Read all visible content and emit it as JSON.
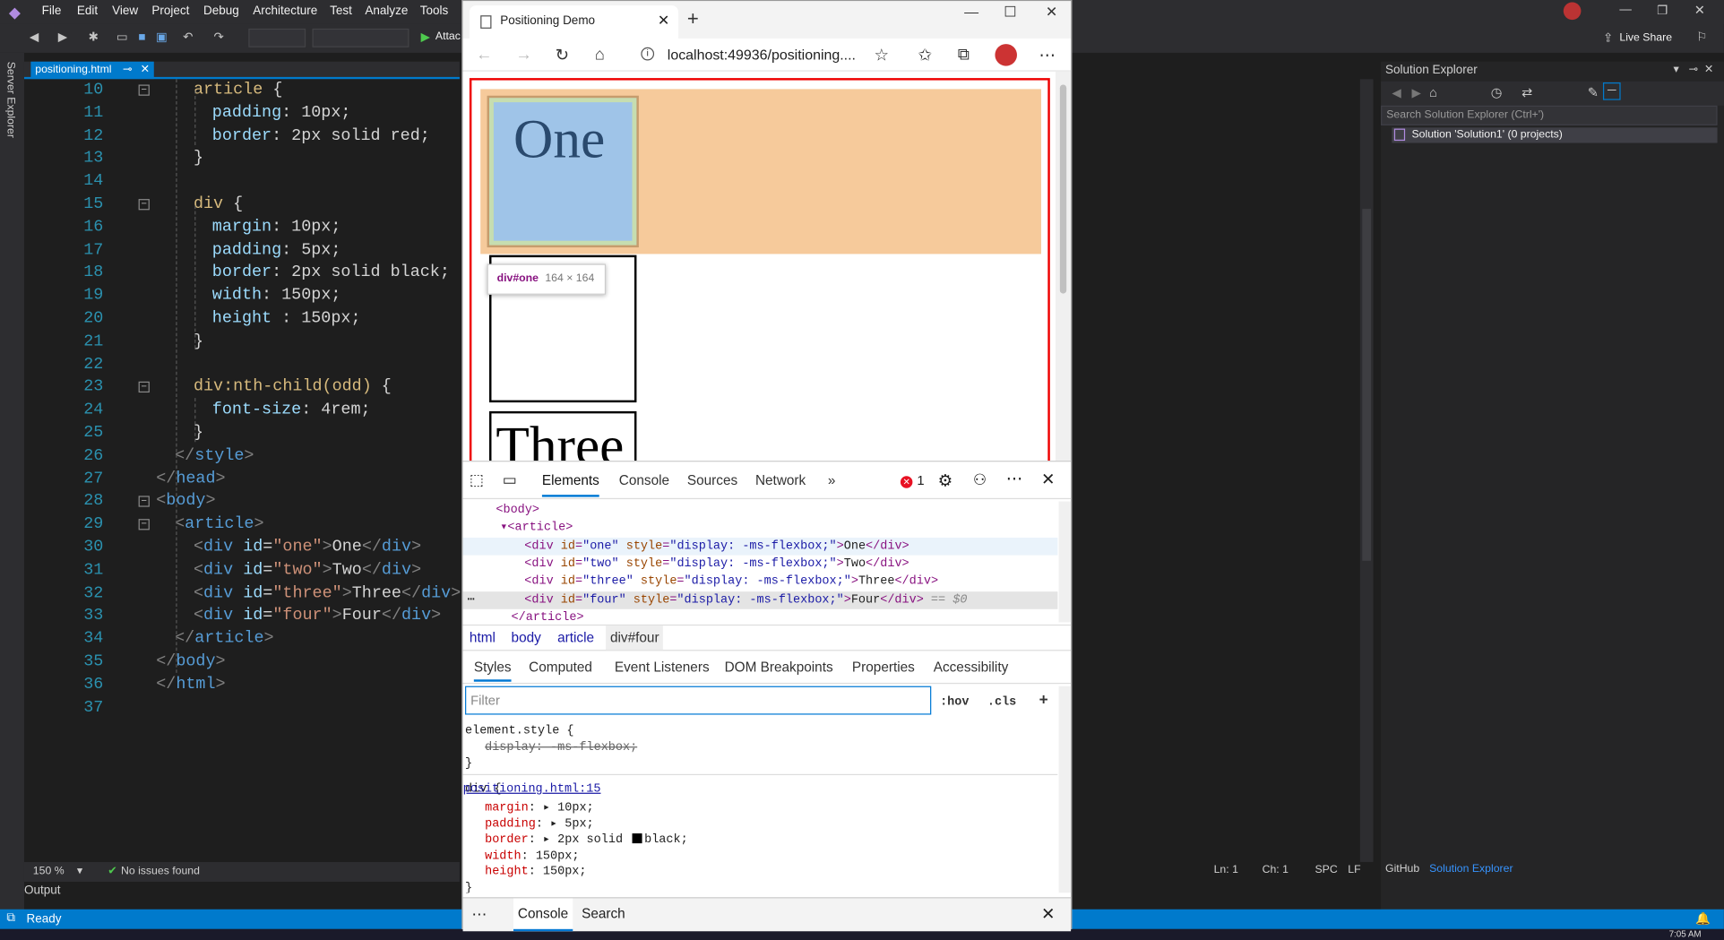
{
  "vs": {
    "menu": [
      "File",
      "Edit",
      "View",
      "Project",
      "Debug",
      "Architecture",
      "Test",
      "Analyze",
      "Tools"
    ],
    "attach_label": "Attac",
    "live_share": "Live Share",
    "server_explorer": "Server Explorer",
    "doc_tab": "positioning.html",
    "zoom": "150 %",
    "issues": "No issues found",
    "ln": "Ln: 1",
    "ch": "Ch: 1",
    "spc": "SPC",
    "lf": "LF",
    "output_label": "Output",
    "status": "Ready",
    "time": "7:05 AM"
  },
  "code_lines": [
    {
      "n": "10",
      "indent": 2,
      "parts": [
        [
          "sel",
          "article "
        ],
        [
          "txt",
          "{"
        ]
      ]
    },
    {
      "n": "11",
      "indent": 3,
      "parts": [
        [
          "prop",
          "padding"
        ],
        [
          "txt",
          ": 10px;"
        ]
      ]
    },
    {
      "n": "12",
      "indent": 3,
      "parts": [
        [
          "prop",
          "border"
        ],
        [
          "txt",
          ": 2px solid red;"
        ]
      ]
    },
    {
      "n": "13",
      "indent": 2,
      "parts": [
        [
          "txt",
          "}"
        ]
      ]
    },
    {
      "n": "14",
      "indent": 0,
      "parts": []
    },
    {
      "n": "15",
      "indent": 2,
      "parts": [
        [
          "sel",
          "div "
        ],
        [
          "txt",
          "{"
        ]
      ]
    },
    {
      "n": "16",
      "indent": 3,
      "parts": [
        [
          "prop",
          "margin"
        ],
        [
          "txt",
          ": 10px;"
        ]
      ]
    },
    {
      "n": "17",
      "indent": 3,
      "parts": [
        [
          "prop",
          "padding"
        ],
        [
          "txt",
          ": 5px;"
        ]
      ]
    },
    {
      "n": "18",
      "indent": 3,
      "parts": [
        [
          "prop",
          "border"
        ],
        [
          "txt",
          ": 2px solid black;"
        ]
      ]
    },
    {
      "n": "19",
      "indent": 3,
      "parts": [
        [
          "prop",
          "width"
        ],
        [
          "txt",
          ": 150px;"
        ]
      ]
    },
    {
      "n": "20",
      "indent": 3,
      "parts": [
        [
          "prop",
          "height"
        ],
        [
          "txt",
          " : 150px;"
        ]
      ]
    },
    {
      "n": "21",
      "indent": 2,
      "parts": [
        [
          "txt",
          "}"
        ]
      ]
    },
    {
      "n": "22",
      "indent": 0,
      "parts": []
    },
    {
      "n": "23",
      "indent": 2,
      "parts": [
        [
          "sel",
          "div:nth-child(odd) "
        ],
        [
          "txt",
          "{"
        ]
      ]
    },
    {
      "n": "24",
      "indent": 3,
      "parts": [
        [
          "prop",
          "font-size"
        ],
        [
          "txt",
          ": 4rem;"
        ]
      ]
    },
    {
      "n": "25",
      "indent": 2,
      "parts": [
        [
          "txt",
          "}"
        ]
      ]
    },
    {
      "n": "26",
      "indent": 1,
      "parts": [
        [
          "tagc",
          "</"
        ],
        [
          "tagn",
          "style"
        ],
        [
          "tagc",
          ">"
        ]
      ]
    },
    {
      "n": "27",
      "indent": 0,
      "parts": [
        [
          "tagc",
          "</"
        ],
        [
          "tagn",
          "head"
        ],
        [
          "tagc",
          ">"
        ]
      ]
    },
    {
      "n": "28",
      "indent": 0,
      "parts": [
        [
          "tagc",
          "<"
        ],
        [
          "tagn",
          "body"
        ],
        [
          "tagc",
          ">"
        ]
      ]
    },
    {
      "n": "29",
      "indent": 1,
      "parts": [
        [
          "tagc",
          "<"
        ],
        [
          "tagn",
          "article"
        ],
        [
          "tagc",
          ">"
        ]
      ]
    },
    {
      "n": "30",
      "indent": 2,
      "parts": [
        [
          "tagc",
          "<"
        ],
        [
          "tagn",
          "div "
        ],
        [
          "attr",
          "id"
        ],
        [
          "txt",
          "="
        ],
        [
          "str",
          "\"one\""
        ],
        [
          "tagc",
          ">"
        ],
        [
          "txt",
          "One"
        ],
        [
          "tagc",
          "</"
        ],
        [
          "tagn",
          "div"
        ],
        [
          "tagc",
          ">"
        ]
      ]
    },
    {
      "n": "31",
      "indent": 2,
      "parts": [
        [
          "tagc",
          "<"
        ],
        [
          "tagn",
          "div "
        ],
        [
          "attr",
          "id"
        ],
        [
          "txt",
          "="
        ],
        [
          "str",
          "\"two\""
        ],
        [
          "tagc",
          ">"
        ],
        [
          "txt",
          "Two"
        ],
        [
          "tagc",
          "</"
        ],
        [
          "tagn",
          "div"
        ],
        [
          "tagc",
          ">"
        ]
      ]
    },
    {
      "n": "32",
      "indent": 2,
      "parts": [
        [
          "tagc",
          "<"
        ],
        [
          "tagn",
          "div "
        ],
        [
          "attr",
          "id"
        ],
        [
          "txt",
          "="
        ],
        [
          "str",
          "\"three\""
        ],
        [
          "tagc",
          ">"
        ],
        [
          "txt",
          "Three"
        ],
        [
          "tagc",
          "</"
        ],
        [
          "tagn",
          "div"
        ],
        [
          "tagc",
          ">"
        ]
      ]
    },
    {
      "n": "33",
      "indent": 2,
      "parts": [
        [
          "tagc",
          "<"
        ],
        [
          "tagn",
          "div "
        ],
        [
          "attr",
          "id"
        ],
        [
          "txt",
          "="
        ],
        [
          "str",
          "\"four\""
        ],
        [
          "tagc",
          ">"
        ],
        [
          "txt",
          "Four"
        ],
        [
          "tagc",
          "</"
        ],
        [
          "tagn",
          "div"
        ],
        [
          "tagc",
          ">"
        ]
      ]
    },
    {
      "n": "34",
      "indent": 1,
      "parts": [
        [
          "tagc",
          "</"
        ],
        [
          "tagn",
          "article"
        ],
        [
          "tagc",
          ">"
        ]
      ]
    },
    {
      "n": "35",
      "indent": 0,
      "parts": [
        [
          "tagc",
          "</"
        ],
        [
          "tagn",
          "body"
        ],
        [
          "tagc",
          ">"
        ]
      ]
    },
    {
      "n": "36",
      "indent": 0,
      "parts": [
        [
          "tagc",
          "</"
        ],
        [
          "tagn",
          "html"
        ],
        [
          "tagc",
          ">"
        ]
      ]
    },
    {
      "n": "37",
      "indent": 0,
      "parts": []
    }
  ],
  "solution": {
    "title": "Solution Explorer",
    "search_placeholder": "Search Solution Explorer (Ctrl+')",
    "item": "Solution 'Solution1' (0 projects)",
    "tab_github": "GitHub",
    "tab_solution": "Solution Explorer"
  },
  "browser": {
    "tab_title": "Positioning Demo",
    "url": "localhost:49936/positioning....",
    "page": {
      "one": "One",
      "three": "Three",
      "tooltip_name": "div#one",
      "tooltip_dim": "164 × 164"
    }
  },
  "devtools": {
    "tabs": [
      "Elements",
      "Console",
      "Sources",
      "Network"
    ],
    "more": "»",
    "error_count": "1",
    "dom": [
      {
        "parts": [
          [
            "tag",
            "<body>"
          ]
        ]
      },
      {
        "parts": [
          [
            "tag",
            "▾<article>"
          ]
        ]
      },
      {
        "parts": [
          [
            "tag",
            "<div "
          ],
          [
            "attr",
            "id"
          ],
          [
            "tag",
            "="
          ],
          [
            "val",
            "\"one\""
          ],
          [
            "tag",
            " "
          ],
          [
            "attr",
            "style"
          ],
          [
            "tag",
            "="
          ],
          [
            "val",
            "\"display: -ms-flexbox;\""
          ],
          [
            "tag",
            ">"
          ],
          [
            "text",
            "One"
          ],
          [
            "tag",
            "</div>"
          ]
        ]
      },
      {
        "parts": [
          [
            "tag",
            "<div "
          ],
          [
            "attr",
            "id"
          ],
          [
            "tag",
            "="
          ],
          [
            "val",
            "\"two\""
          ],
          [
            "tag",
            " "
          ],
          [
            "attr",
            "style"
          ],
          [
            "tag",
            "="
          ],
          [
            "val",
            "\"display: -ms-flexbox;\""
          ],
          [
            "tag",
            ">"
          ],
          [
            "text",
            "Two"
          ],
          [
            "tag",
            "</div>"
          ]
        ]
      },
      {
        "parts": [
          [
            "tag",
            "<div "
          ],
          [
            "attr",
            "id"
          ],
          [
            "tag",
            "="
          ],
          [
            "val",
            "\"three\""
          ],
          [
            "tag",
            " "
          ],
          [
            "attr",
            "style"
          ],
          [
            "tag",
            "="
          ],
          [
            "val",
            "\"display: -ms-flexbox;\""
          ],
          [
            "tag",
            ">"
          ],
          [
            "text",
            "Three"
          ],
          [
            "tag",
            "</div>"
          ]
        ]
      },
      {
        "parts": [
          [
            "tag",
            "<div "
          ],
          [
            "attr",
            "id"
          ],
          [
            "tag",
            "="
          ],
          [
            "val",
            "\"four\""
          ],
          [
            "tag",
            " "
          ],
          [
            "attr",
            "style"
          ],
          [
            "tag",
            "="
          ],
          [
            "val",
            "\"display: -ms-flexbox;\""
          ],
          [
            "tag",
            ">"
          ],
          [
            "text",
            "Four"
          ],
          [
            "tag",
            "</div>"
          ],
          [
            "dim",
            " == $0"
          ]
        ]
      },
      {
        "parts": [
          [
            "tag",
            "</article>"
          ]
        ]
      }
    ],
    "breadcrumbs": [
      "html",
      "body",
      "article",
      "div#four"
    ],
    "style_tabs": [
      "Styles",
      "Computed",
      "Event Listeners",
      "DOM Breakpoints",
      "Properties",
      "Accessibility"
    ],
    "filter_placeholder": "Filter",
    "hov": ":hov",
    "cls": ".cls",
    "element_style_selector": "element.style {",
    "element_style_prop": "display: -ms-flexbox;",
    "close_brace": "}",
    "div_selector": "div {",
    "div_link": "positioning.html:15",
    "div_props": [
      {
        "name": "margin",
        "value": "10px;",
        "arrow": true
      },
      {
        "name": "padding",
        "value": "5px;",
        "arrow": true
      },
      {
        "name": "border",
        "value": "2px solid ",
        "swatch": "black;",
        "arrow": true
      },
      {
        "name": "width",
        "value": "150px;",
        "arrow": false
      },
      {
        "name": "height",
        "value": "150px;",
        "arrow": false
      }
    ],
    "drawer_console": "Console",
    "drawer_search": "Search"
  }
}
